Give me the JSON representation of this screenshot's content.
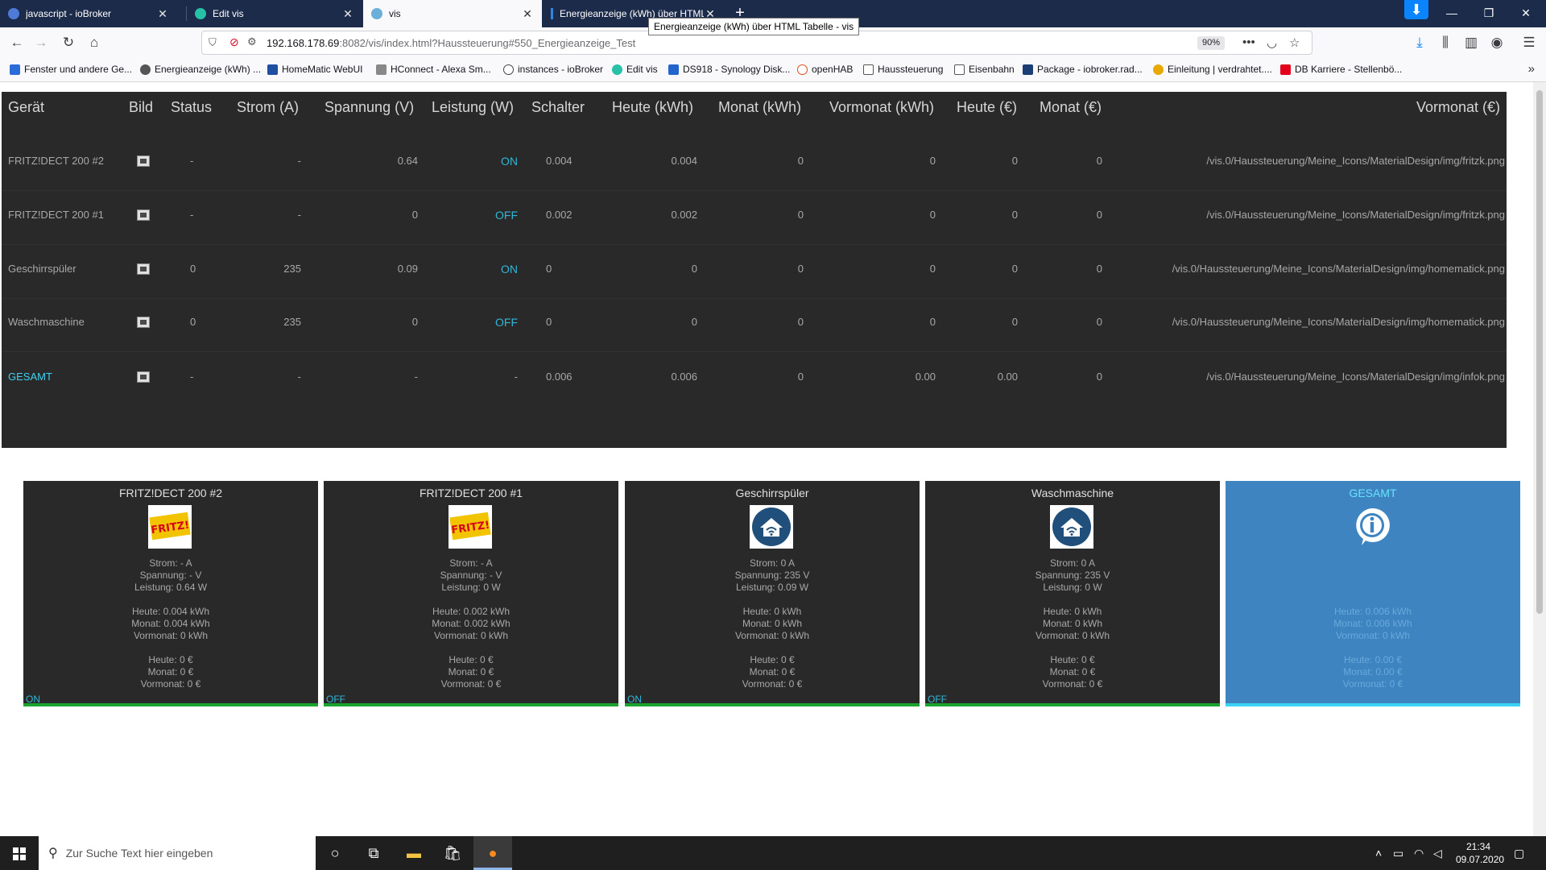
{
  "tabs": [
    {
      "title": "javascript - ioBroker",
      "color": "#4f7bd8"
    },
    {
      "title": "Edit vis",
      "color": "#27c1a7"
    },
    {
      "title": "vis",
      "color": "#6ab0d8"
    },
    {
      "title": "Energieanzeige (kWh) über HTML Tabelle - vis",
      "color": "#2e86de"
    }
  ],
  "tooltip": "Energieanzeige (kWh) über HTML Tabelle - vis",
  "address": {
    "host": "192.168.178.69",
    "path": ":8082/vis/index.html?Haussteuerung#550_Energieanzeige_Test",
    "zoom": "90%"
  },
  "bookmarks": [
    "Fenster und andere Ge...",
    "Energieanzeige (kWh) ...",
    "HomeMatic WebUI",
    "HConnect - Alexa Sm...",
    "instances - ioBroker",
    "Edit vis",
    "DS918 - Synology Disk...",
    "openHAB",
    "Haussteuerung",
    "Eisenbahn",
    "Package - iobroker.rad...",
    "Einleitung | verdrahtet....",
    "DB Karriere - Stellenbö..."
  ],
  "table": {
    "headers": [
      "Gerät",
      "Bild",
      "Status",
      "Strom (A)",
      "Spannung (V)",
      "Leistung (W)",
      "Schalter",
      "Heute (kWh)",
      "Monat (kWh)",
      "Vormonat (kWh)",
      "Heute (€)",
      "Monat (€)",
      "Vormonat (€)"
    ],
    "rows": [
      {
        "cells": [
          "FRITZ!DECT 200 #2",
          "-",
          "-",
          "0.64",
          "ON",
          "0.004",
          "0.004",
          "0",
          "0",
          "0",
          "0",
          "/vis.0/Haussteuerung/Meine_Icons/MaterialDesign/img/fritzk.png"
        ]
      },
      {
        "cells": [
          "FRITZ!DECT 200 #1",
          "-",
          "-",
          "0",
          "OFF",
          "0.002",
          "0.002",
          "0",
          "0",
          "0",
          "0",
          "/vis.0/Haussteuerung/Meine_Icons/MaterialDesign/img/fritzk.png"
        ]
      },
      {
        "cells": [
          "Geschirrspüler",
          "0",
          "235",
          "0.09",
          "ON",
          "0",
          "0",
          "0",
          "0",
          "0",
          "0",
          "/vis.0/Haussteuerung/Meine_Icons/MaterialDesign/img/homematick.png"
        ]
      },
      {
        "cells": [
          "Waschmaschine",
          "0",
          "235",
          "0",
          "OFF",
          "0",
          "0",
          "0",
          "0",
          "0",
          "0",
          "/vis.0/Haussteuerung/Meine_Icons/MaterialDesign/img/homematick.png"
        ]
      },
      {
        "cells": [
          "GESAMT",
          "-",
          "-",
          "-",
          "-",
          "0.006",
          "0.006",
          "0",
          "0.00",
          "0.00",
          "0",
          "/vis.0/Haussteuerung/Meine_Icons/MaterialDesign/img/infok.png"
        ]
      }
    ]
  },
  "cards": [
    {
      "title": "FRITZ!DECT 200 #2",
      "icon": "fritz-icon",
      "strom": "Strom: - A",
      "spannung": "Spannung: - V",
      "leistung": "Leistung: 0.64 W",
      "heute_kwh": "Heute: 0.004 kWh",
      "monat_kwh": "Monat: 0.004 kWh",
      "vormonat_kwh": "Vormonat: 0 kWh",
      "heute_eur": "Heute: 0 €",
      "monat_eur": "Monat: 0 €",
      "vormonat_eur": "Vormonat: 0 €",
      "state": "ON"
    },
    {
      "title": "FRITZ!DECT 200 #1",
      "icon": "fritz-icon",
      "strom": "Strom: - A",
      "spannung": "Spannung: - V",
      "leistung": "Leistung: 0 W",
      "heute_kwh": "Heute: 0.002 kWh",
      "monat_kwh": "Monat: 0.002 kWh",
      "vormonat_kwh": "Vormonat: 0 kWh",
      "heute_eur": "Heute: 0 €",
      "monat_eur": "Monat: 0 €",
      "vormonat_eur": "Vormonat: 0 €",
      "state": "OFF"
    },
    {
      "title": "Geschirrspüler",
      "icon": "homematic-icon",
      "strom": "Strom: 0 A",
      "spannung": "Spannung: 235 V",
      "leistung": "Leistung: 0.09 W",
      "heute_kwh": "Heute: 0 kWh",
      "monat_kwh": "Monat: 0 kWh",
      "vormonat_kwh": "Vormonat: 0 kWh",
      "heute_eur": "Heute: 0 €",
      "monat_eur": "Monat: 0 €",
      "vormonat_eur": "Vormonat: 0 €",
      "state": "ON"
    },
    {
      "title": "Waschmaschine",
      "icon": "homematic-icon",
      "strom": "Strom: 0 A",
      "spannung": "Spannung: 235 V",
      "leistung": "Leistung: 0 W",
      "heute_kwh": "Heute: 0 kWh",
      "monat_kwh": "Monat: 0 kWh",
      "vormonat_kwh": "Vormonat: 0 kWh",
      "heute_eur": "Heute: 0 €",
      "monat_eur": "Monat: 0 €",
      "vormonat_eur": "Vormonat: 0 €",
      "state": "OFF"
    },
    {
      "title": "GESAMT",
      "icon": "info-icon",
      "heute_kwh": "Heute: 0.006 kWh",
      "monat_kwh": "Monat: 0.006 kWh",
      "vormonat_kwh": "Vormonat: 0 kWh",
      "heute_eur": "Heute: 0.00 €",
      "monat_eur": "Monat: 0.00 €",
      "vormonat_eur": "Vormonat: 0 €"
    }
  ],
  "taskbar": {
    "search_placeholder": "Zur Suche Text hier eingeben",
    "time": "21:34",
    "date": "09.07.2020"
  },
  "colors": {
    "panel": "#292929",
    "accent_cyan": "#2fb8d8",
    "card_bar_green": "#1aa32e",
    "total_card_blue": "#3d84c1"
  }
}
